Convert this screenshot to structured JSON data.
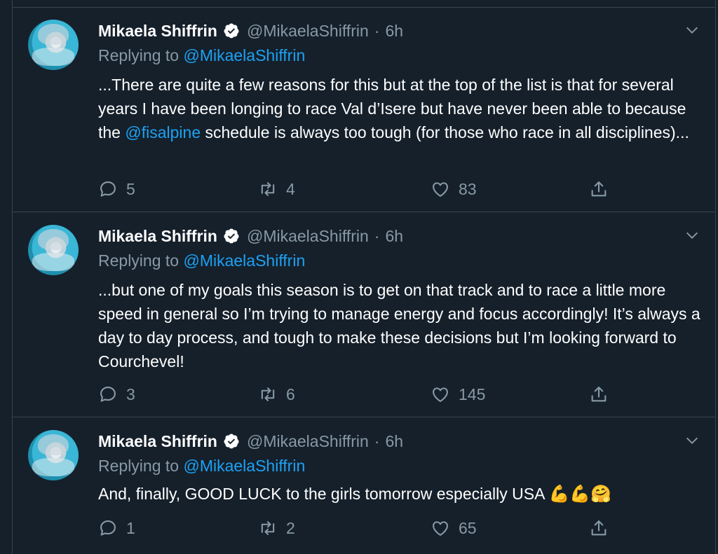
{
  "tweets": [
    {
      "name": "Mikaela Shiffrin",
      "handle": "@MikaelaShiffrin",
      "time": "6h",
      "replying_label": "Replying to",
      "replying_to": "@MikaelaShiffrin",
      "text_parts": [
        "...There are quite a few reasons for this but at the top of the list is that for several years I have been longing to race Val d’Isere but have never been able to because the ",
        "@fisalpine",
        " schedule is always too tough (for those who race in all disciplines)..."
      ],
      "replies": "5",
      "retweets": "4",
      "likes": "83"
    },
    {
      "name": "Mikaela Shiffrin",
      "handle": "@MikaelaShiffrin",
      "time": "6h",
      "replying_label": "Replying to",
      "replying_to": "@MikaelaShiffrin",
      "text": "...but one of my goals this season is to get on that track and to race a little more speed in general so I’m trying to manage energy and focus accordingly! It’s always a day to day process, and tough to make these decisions but I’m looking forward to Courchevel!",
      "replies": "3",
      "retweets": "6",
      "likes": "145"
    },
    {
      "name": "Mikaela Shiffrin",
      "handle": "@MikaelaShiffrin",
      "time": "6h",
      "replying_label": "Replying to",
      "replying_to": "@MikaelaShiffrin",
      "text": "And, finally, GOOD LUCK to the girls tomorrow especially USA ",
      "emoji": "💪💪🤗",
      "replies": "1",
      "retweets": "2",
      "likes": "65"
    }
  ],
  "colors": {
    "background": "#15202b",
    "border": "#38444d",
    "secondary_text": "#8899a6",
    "link": "#1da1f2"
  }
}
